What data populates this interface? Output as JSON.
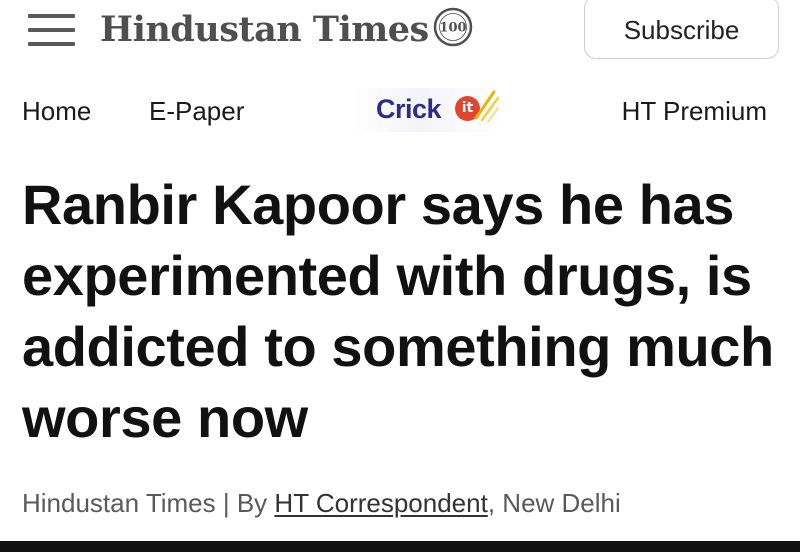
{
  "header": {
    "brand": "Hindustan Times",
    "seal_label": "100",
    "subscribe_label": "Subscribe",
    "menu_icon": "hamburger-menu-icon"
  },
  "nav": {
    "items": [
      {
        "label": "Home"
      },
      {
        "label": "E-Paper"
      },
      {
        "label": "Crick",
        "badge": "it"
      },
      {
        "label": "HT Premium"
      }
    ]
  },
  "article": {
    "headline": "Ranbir Kapoor says he has experimented with drugs, is addicted to something much worse now",
    "publication": "Hindustan Times | By ",
    "author": "HT Correspondent",
    "location": ", New Delhi"
  },
  "colors": {
    "text": "#111111",
    "logo": "#4f4f4f",
    "crickit_blue": "#2c2c8a",
    "crickit_red": "#e2452f",
    "byline": "#5a5a5a"
  }
}
